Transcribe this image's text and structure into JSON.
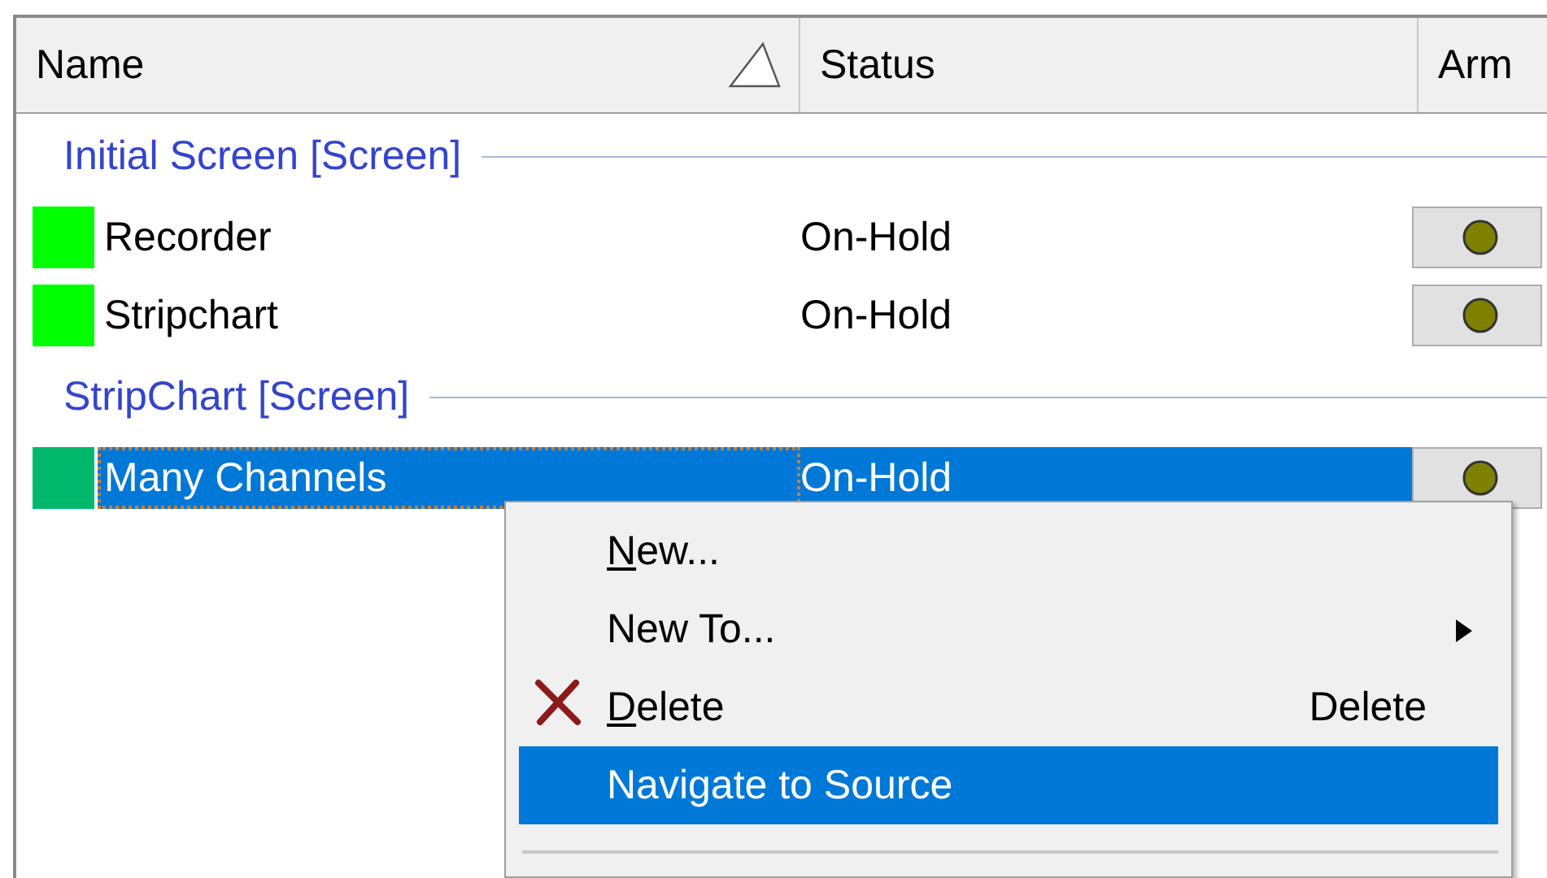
{
  "columns": [
    {
      "label": "Name"
    },
    {
      "label": "Status"
    },
    {
      "label": "Arm"
    }
  ],
  "groups": [
    {
      "title": "Initial Screen [Screen]",
      "rows": [
        {
          "name": "Recorder",
          "status": "On-Hold",
          "color": "#00ff00",
          "selected": false
        },
        {
          "name": "Stripchart",
          "status": "On-Hold",
          "color": "#00ff00",
          "selected": false
        }
      ]
    },
    {
      "title": "StripChart [Screen]",
      "rows": [
        {
          "name": "Many Channels",
          "status": "On-Hold",
          "color": "#00b86b",
          "selected": true
        }
      ]
    }
  ],
  "context_menu": {
    "items": [
      {
        "kind": "plain",
        "label": "New...",
        "mnemonic": true,
        "selected": false
      },
      {
        "kind": "submenu",
        "label": "New To...",
        "mnemonic": false,
        "selected": false
      },
      {
        "kind": "delete",
        "label": "Delete",
        "mnemonic": true,
        "shortcut": "Delete",
        "selected": false
      },
      {
        "kind": "plain",
        "label": "Navigate to Source",
        "mnemonic": false,
        "selected": true
      },
      {
        "kind": "separator"
      }
    ]
  }
}
